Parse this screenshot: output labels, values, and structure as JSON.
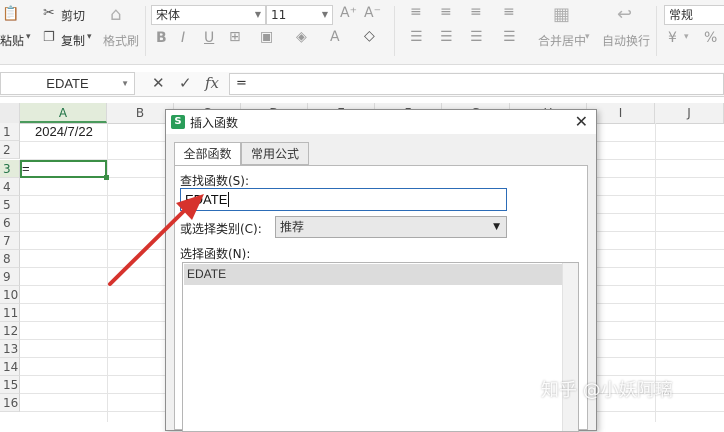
{
  "ribbon": {
    "paste_label": "粘贴",
    "cut_label": "剪切",
    "copy_label": "复制",
    "format_painter_label": "格式刷",
    "font_name": "宋体",
    "font_size": "11",
    "merge_center_label": "合并居中",
    "wrap_text_label": "自动换行",
    "number_format": "常规",
    "currency_symbol": "¥",
    "percent_symbol": "%"
  },
  "formula_bar": {
    "name_box": "EDATE",
    "formula": "="
  },
  "grid": {
    "columns": [
      "A",
      "B",
      "C",
      "D",
      "E",
      "F",
      "G",
      "H",
      "I",
      "J"
    ],
    "rows": [
      "1",
      "2",
      "3",
      "4",
      "5",
      "6",
      "7",
      "8",
      "9",
      "10",
      "11",
      "12",
      "13",
      "14",
      "15",
      "16"
    ],
    "cell_A1": "2024/7/22",
    "cell_A3": "=",
    "accent_color": "#3b8f46"
  },
  "dialog": {
    "title": "插入函数",
    "tabs": [
      "全部函数",
      "常用公式"
    ],
    "search_label": "查找函数(S):",
    "search_value": "EDATE",
    "category_label": "或选择类别(C):",
    "category_value": "推荐",
    "select_label": "选择函数(N):",
    "functions": [
      "EDATE"
    ]
  },
  "watermark": "知乎 @小妖阿璃",
  "arrow_color": "#d6332d"
}
